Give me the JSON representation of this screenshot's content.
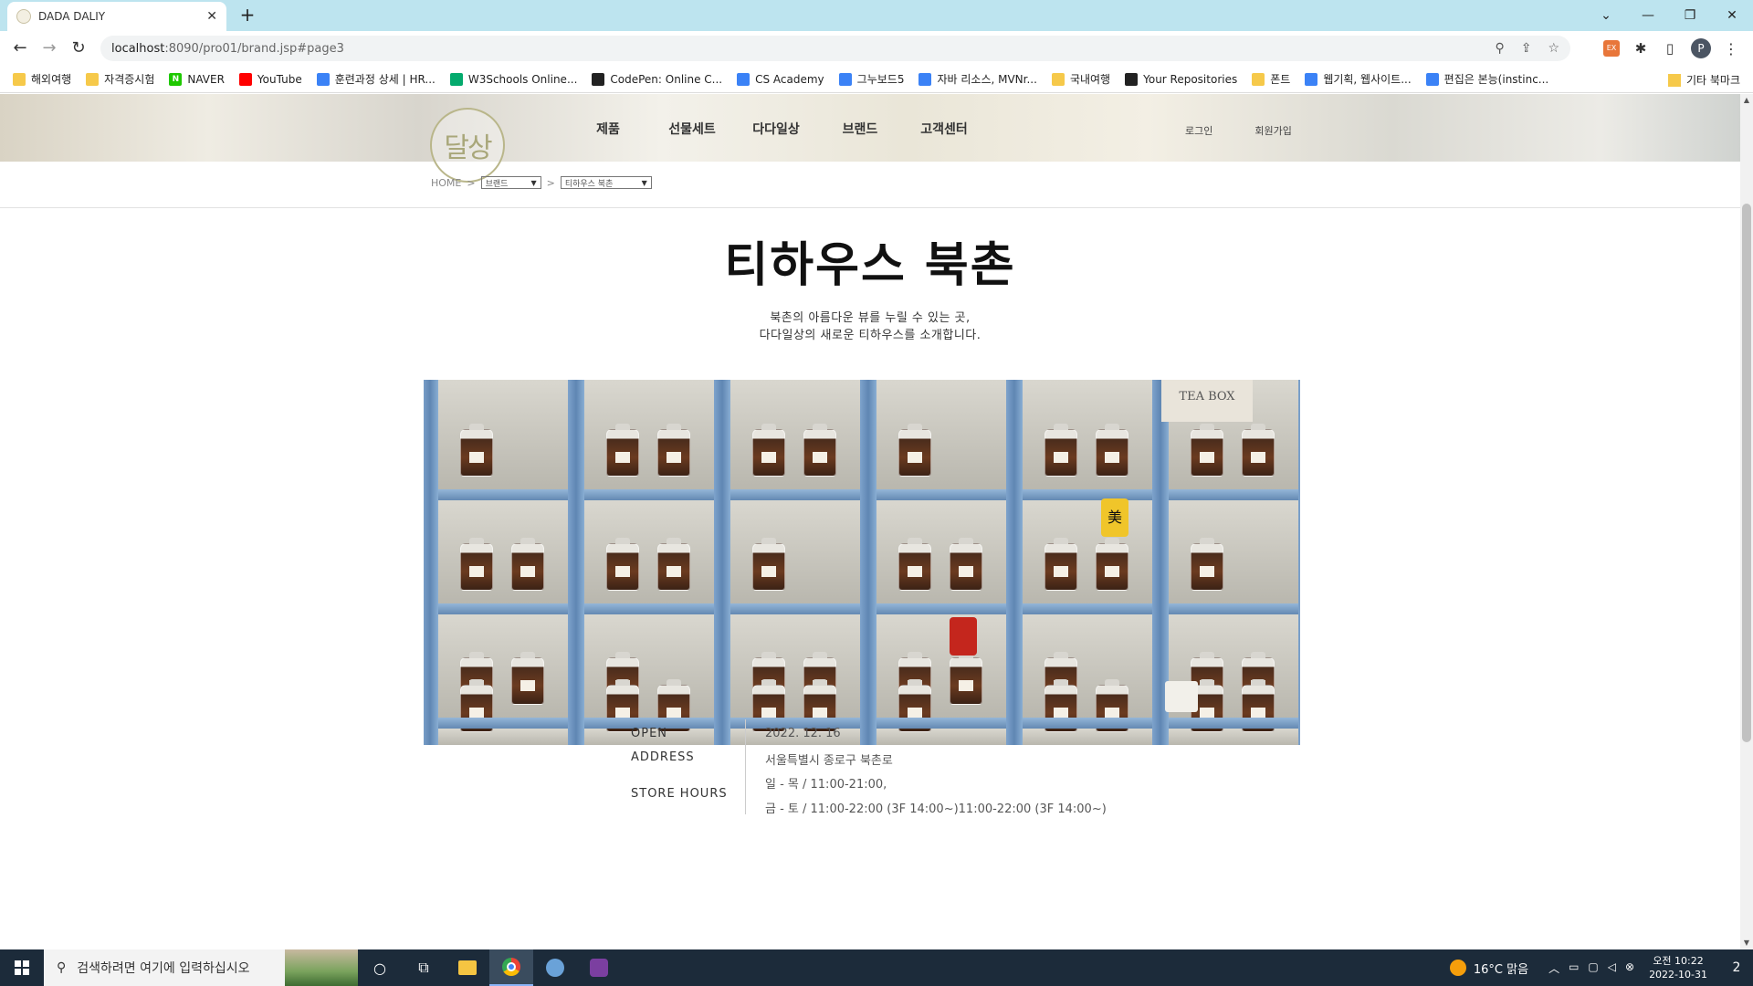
{
  "browser": {
    "tab_title": "DADA DALIY",
    "tab_close": "✕",
    "new_tab": "+",
    "url_host": "localhost",
    "url_path": ":8090/pro01/brand.jsp#page3",
    "window_controls": [
      "⌄",
      "—",
      "❐",
      "✕"
    ]
  },
  "bookmarks": [
    {
      "label": "해외여행",
      "icon": "folder"
    },
    {
      "label": "자격증시험",
      "icon": "folder"
    },
    {
      "label": "NAVER",
      "icon": "naver"
    },
    {
      "label": "YouTube",
      "icon": "youtube"
    },
    {
      "label": "훈련과정 상세 | HR...",
      "icon": "generic"
    },
    {
      "label": "W3Schools Online...",
      "icon": "w3schools"
    },
    {
      "label": "CodePen: Online C...",
      "icon": "codepen"
    },
    {
      "label": "CS Academy",
      "icon": "generic"
    },
    {
      "label": "그누보드5",
      "icon": "generic"
    },
    {
      "label": "자바 리소스, MVNr...",
      "icon": "generic"
    },
    {
      "label": "국내여행",
      "icon": "folder"
    },
    {
      "label": "Your Repositories",
      "icon": "github"
    },
    {
      "label": "폰트",
      "icon": "folder"
    },
    {
      "label": "웹기획, 웹사이트...",
      "icon": "generic"
    },
    {
      "label": "편집은 본능(instinc...",
      "icon": "generic"
    }
  ],
  "bookmarks_more": "»",
  "bookmarks_other": "기타 북마크",
  "site": {
    "logo_text": "달상",
    "nav": [
      "제품",
      "선물세트",
      "다다일상",
      "브랜드",
      "고객센터"
    ],
    "util": [
      "로그인",
      "회원가입"
    ],
    "breadcrumb_home": "HOME",
    "breadcrumb_sep": ">",
    "breadcrumb_select1": "브랜드",
    "breadcrumb_select2": "티하우스 북촌"
  },
  "page": {
    "title": "티하우스 북촌",
    "desc_line1": "북촌의 아름다운 뷰를 누릴 수 있는 곳,",
    "desc_line2": "다다일상의 새로운 티하우스를 소개합니다.",
    "hero_box_text": "TEA BOX",
    "hero_tin_text": "美"
  },
  "store_info": {
    "open_label": "OPEN",
    "address_label": "ADDRESS",
    "hours_label": "STORE HOURS",
    "open_value": "2022. 12. 16",
    "address_value": "서울특별시 종로구 북촌로",
    "hours_line1": "일 - 목 / 11:00-21:00,",
    "hours_line2": "금 - 토 / 11:00-22:00 (3F 14:00~)11:00-22:00 (3F 14:00~)"
  },
  "taskbar": {
    "search_placeholder": "검색하려면 여기에 입력하십시오",
    "weather": "16°C  맑음",
    "time": "오전 10:22",
    "date": "2022-10-31",
    "notif_count": "2"
  }
}
